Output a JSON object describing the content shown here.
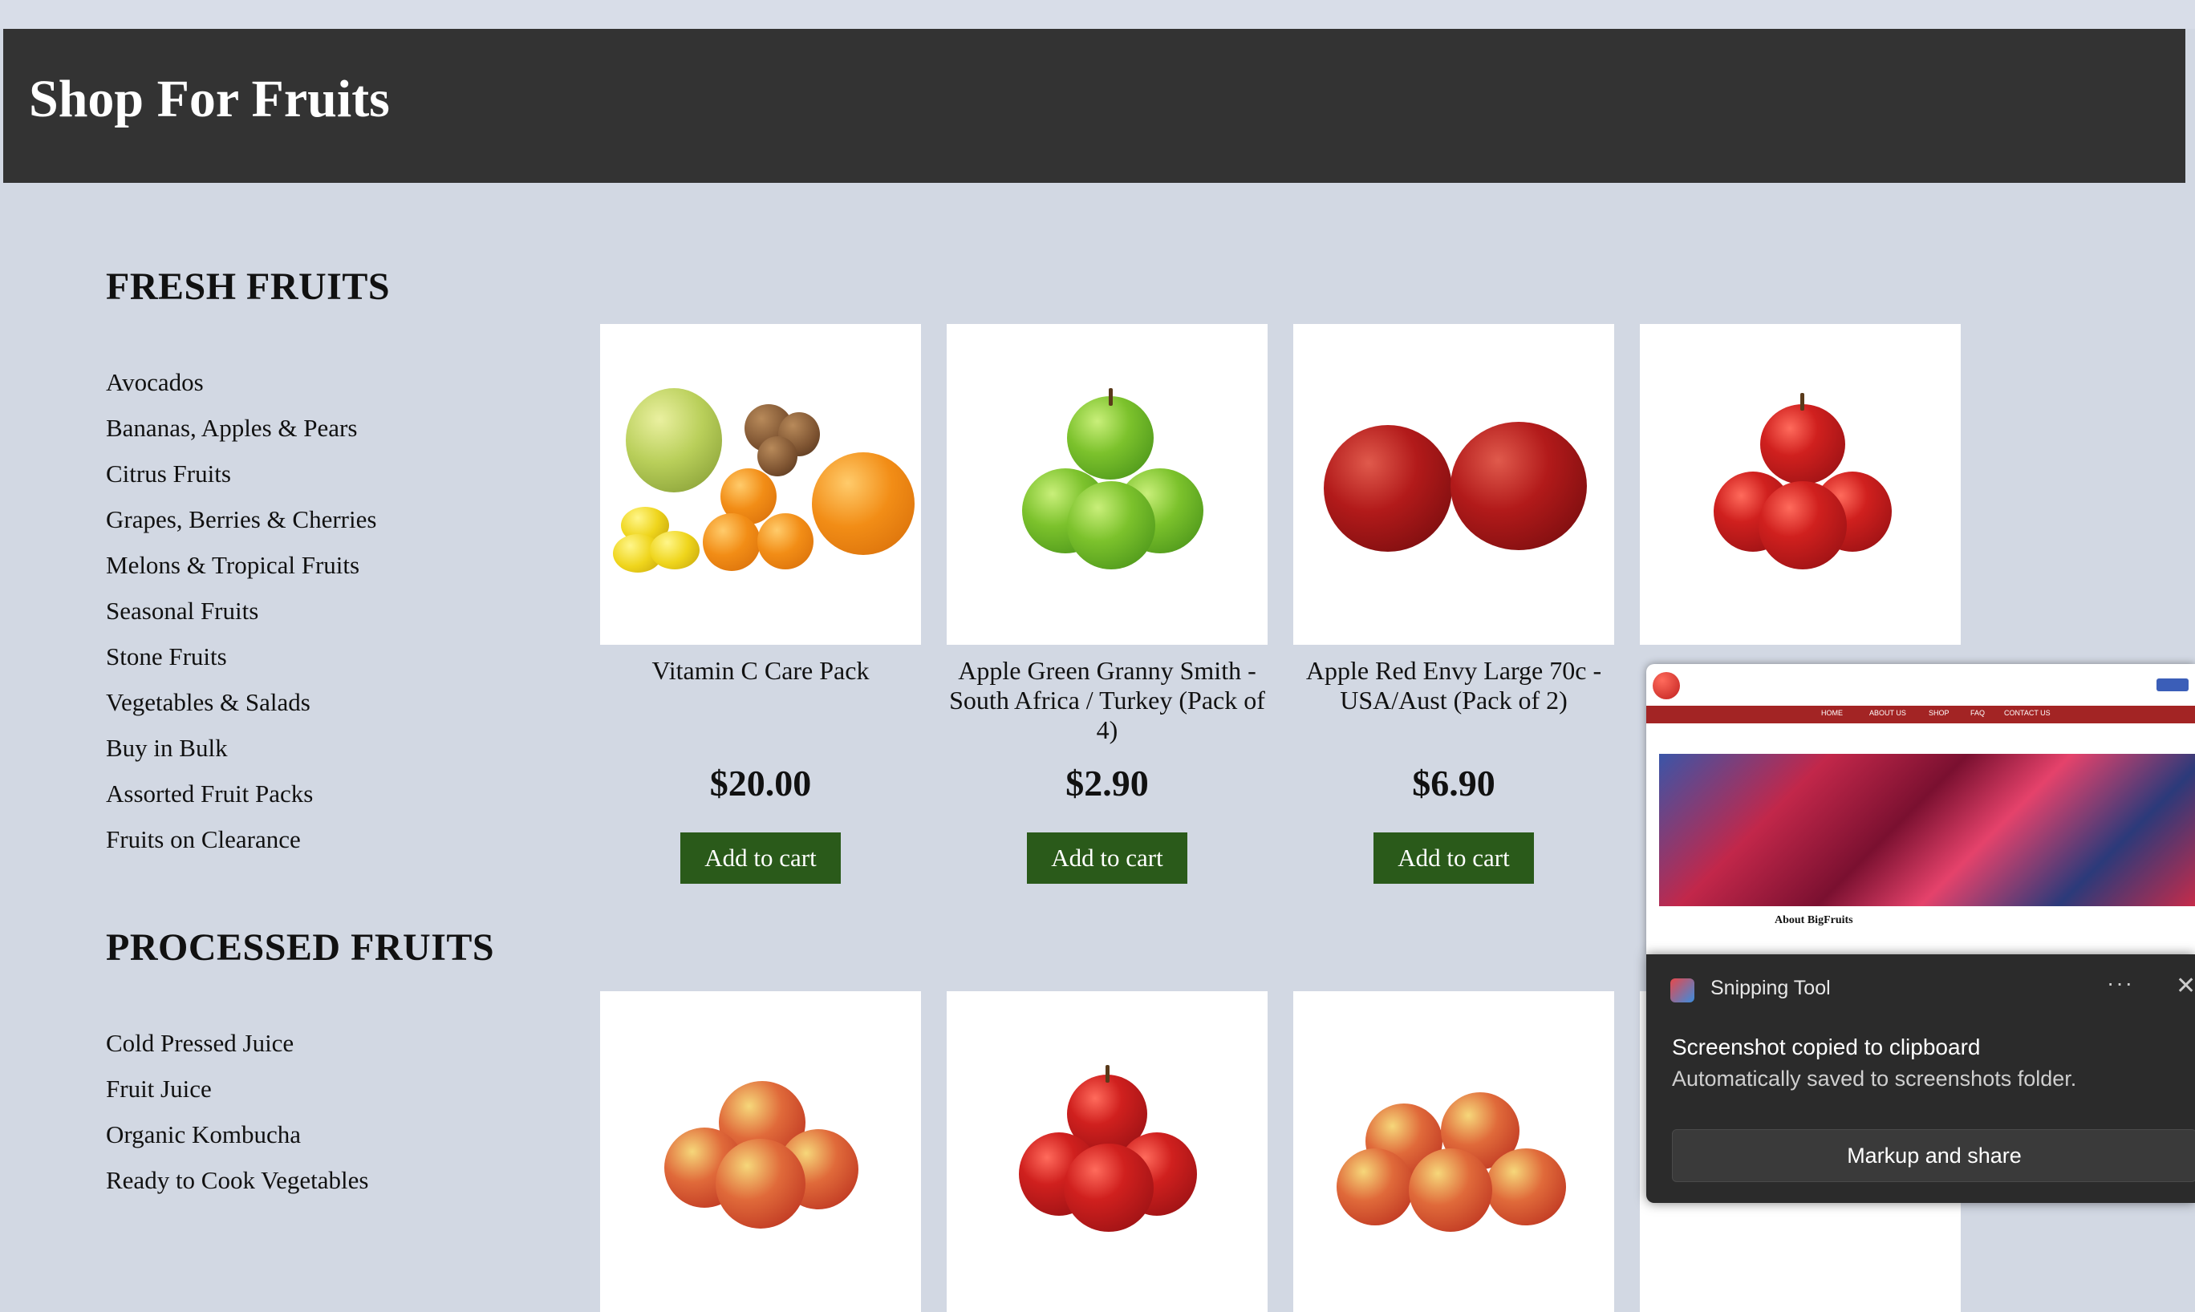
{
  "header": {
    "title": "Shop For Fruits"
  },
  "sidebar": {
    "fresh_title": "FRESH FRUITS",
    "fresh_items": [
      "Avocados",
      "Bananas, Apples & Pears",
      "Citrus Fruits",
      "Grapes, Berries & Cherries",
      "Melons & Tropical Fruits",
      "Seasonal Fruits",
      "Stone Fruits",
      "Vegetables & Salads",
      "Buy in Bulk",
      "Assorted Fruit Packs",
      "Fruits on Clearance"
    ],
    "processed_title": "PROCESSED FRUITS",
    "processed_items": [
      "Cold Pressed Juice",
      "Fruit Juice",
      "Organic Kombucha",
      "Ready to Cook Vegetables"
    ]
  },
  "products": [
    {
      "name": "Vitamin C Care Pack",
      "price": "$20.00",
      "button": "Add to cart"
    },
    {
      "name": "Apple Green Granny Smith - South Africa / Turkey (Pack of 4)",
      "price": "$2.90",
      "button": "Add to cart"
    },
    {
      "name": "Apple Red Envy Large 70c - USA/Aust (Pack of 2)",
      "price": "$6.90",
      "button": "Add to cart"
    }
  ],
  "snip_preview": {
    "nav": [
      "HOME",
      "ABOUT US",
      "SHOP",
      "FAQ",
      "CONTACT US"
    ],
    "heading": "About BigFruits"
  },
  "toast": {
    "app_name": "Snipping Tool",
    "more": "···",
    "close": "✕",
    "message": "Screenshot copied to clipboard",
    "detail": "Automatically saved to screenshots folder.",
    "action": "Markup and share"
  }
}
